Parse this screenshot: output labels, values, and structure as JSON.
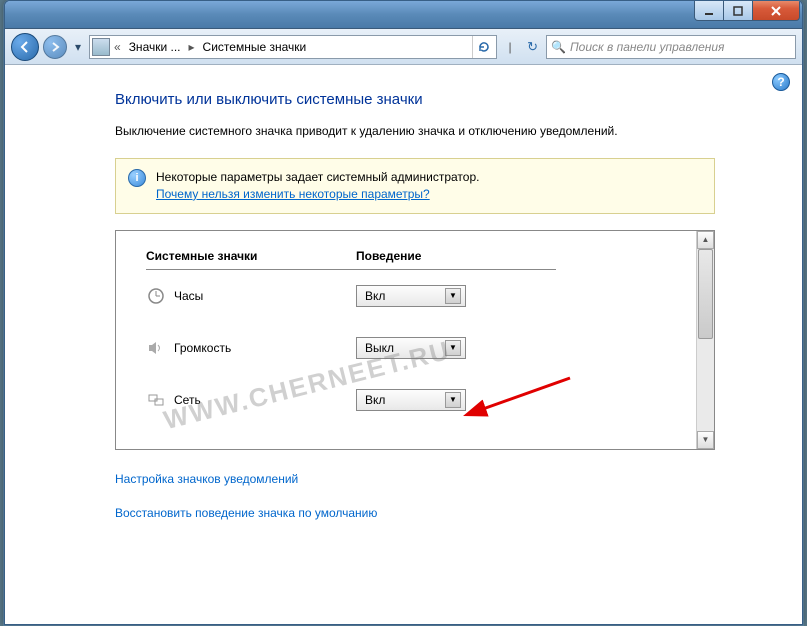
{
  "window": {
    "min_tooltip": "Свернуть",
    "max_tooltip": "Развернуть",
    "close_tooltip": "Закрыть"
  },
  "breadcrumb": {
    "part1": "Значки ...",
    "part2": "Системные значки"
  },
  "search": {
    "placeholder": "Поиск в панели управления"
  },
  "page": {
    "title": "Включить или выключить системные значки",
    "description": "Выключение системного значка приводит к удалению значка и отключению уведомлений."
  },
  "banner": {
    "text": "Некоторые параметры задает системный администратор.",
    "link": "Почему нельзя изменить некоторые параметры?"
  },
  "table": {
    "col1": "Системные значки",
    "col2": "Поведение",
    "rows": [
      {
        "icon": "clock",
        "label": "Часы",
        "value": "Вкл"
      },
      {
        "icon": "volume",
        "label": "Громкость",
        "value": "Выкл"
      },
      {
        "icon": "network",
        "label": "Сеть",
        "value": "Вкл"
      }
    ]
  },
  "links": {
    "customize": "Настройка значков уведомлений",
    "restore": "Восстановить поведение значка по умолчанию"
  },
  "watermark": "WWW.CHERNEET.RU"
}
